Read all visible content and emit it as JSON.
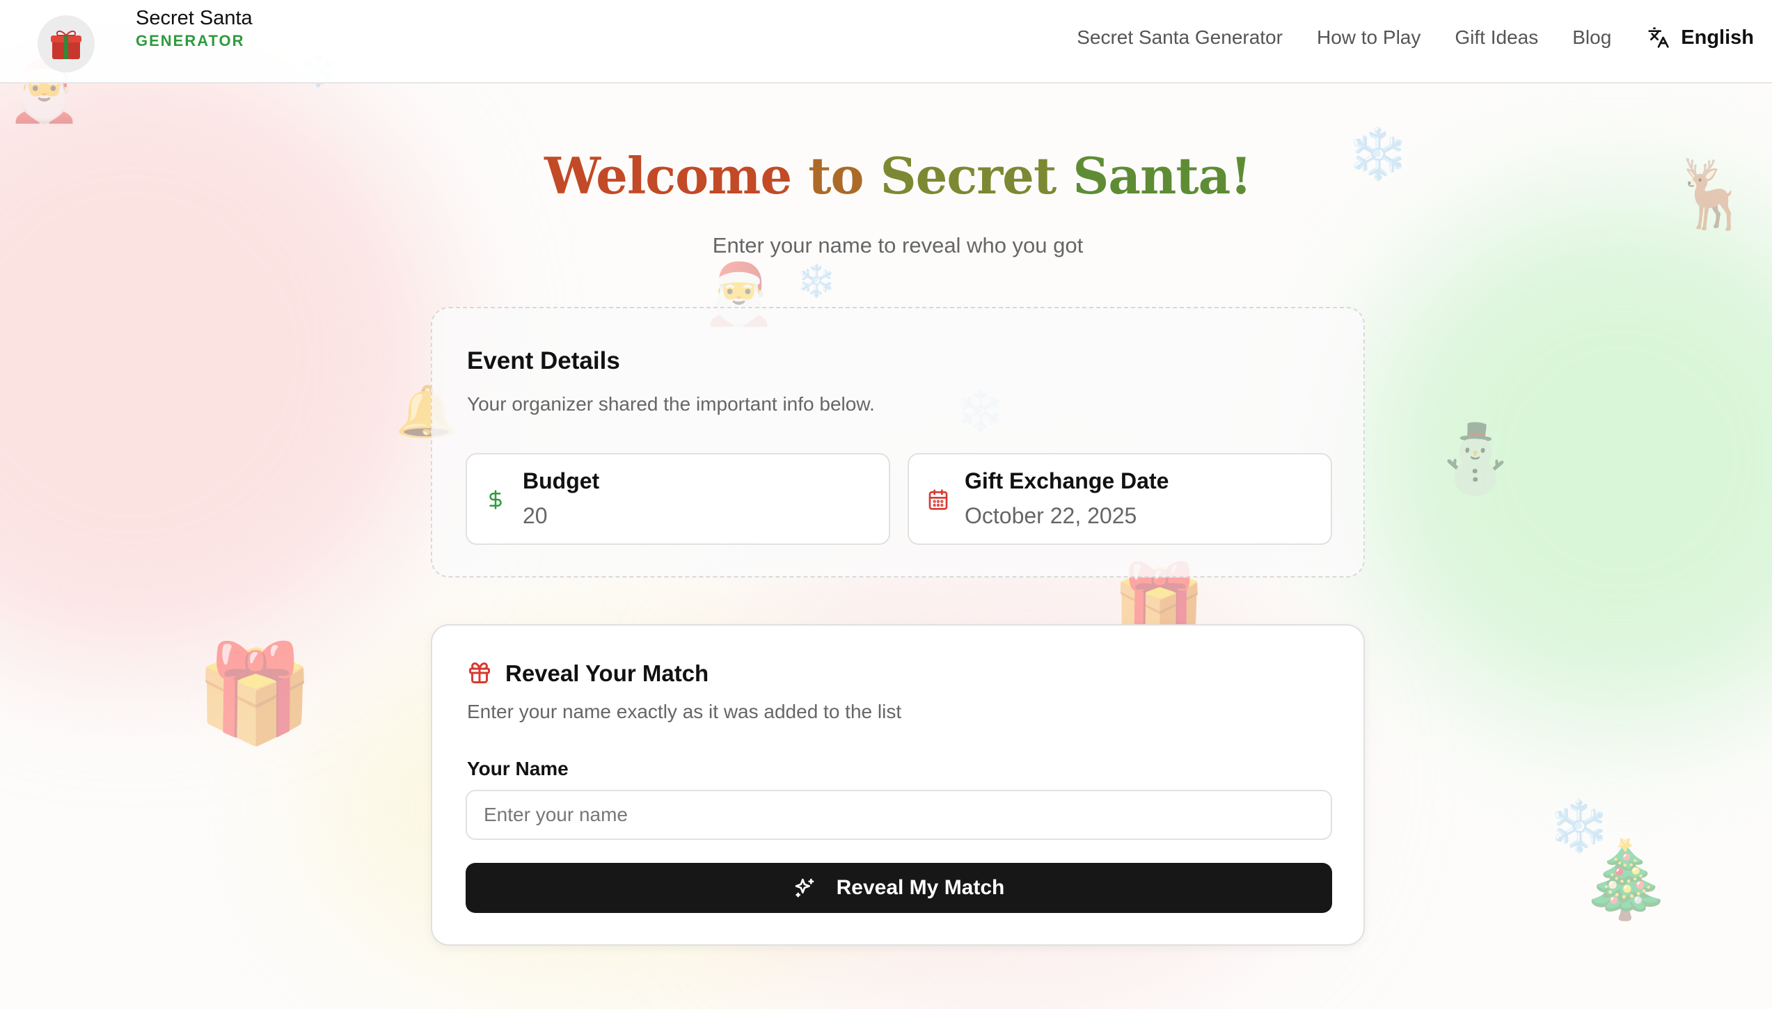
{
  "brand": {
    "title": "Secret Santa",
    "subtitle": "GENERATOR"
  },
  "nav": {
    "items": [
      {
        "label": "Secret Santa Generator"
      },
      {
        "label": "How to Play"
      },
      {
        "label": "Gift Ideas"
      },
      {
        "label": "Blog"
      }
    ],
    "language": "English"
  },
  "hero": {
    "title_words": [
      "Welcome",
      "to",
      "Secret",
      "Santa!"
    ],
    "subtitle": "Enter your name to reveal who you got"
  },
  "event": {
    "heading": "Event Details",
    "description": "Your organizer shared the important info below.",
    "budget": {
      "label": "Budget",
      "value": "20"
    },
    "date": {
      "label": "Gift Exchange Date",
      "value": "October 22, 2025"
    }
  },
  "reveal": {
    "heading": "Reveal Your Match",
    "description": "Enter your name exactly as it was added to the list",
    "field_label": "Your Name",
    "input_value": "",
    "placeholder": "Enter your name",
    "button_label": "Reveal My Match"
  },
  "icons": {
    "logo": "gift-icon",
    "language": "translate-icon",
    "budget": "dollar-icon",
    "date": "calendar-icon",
    "reveal": "gift-icon",
    "button": "sparkles-icon"
  },
  "decorations": [
    "🎅",
    "❄️",
    "❄️",
    "🦌",
    "❄️",
    "🎅",
    "🔔",
    "❄️",
    "⛄",
    "🎁",
    "🎁",
    "❄️",
    "🎄"
  ],
  "colors": {
    "brand_green": "#2f9a3f",
    "title_gradient_start": "#c24a26",
    "title_gradient_end": "#5e8c34",
    "dollar_green": "#2f9a3f",
    "calendar_red": "#d83a32",
    "gift_red": "#d83a32",
    "button_bg": "#171717"
  }
}
